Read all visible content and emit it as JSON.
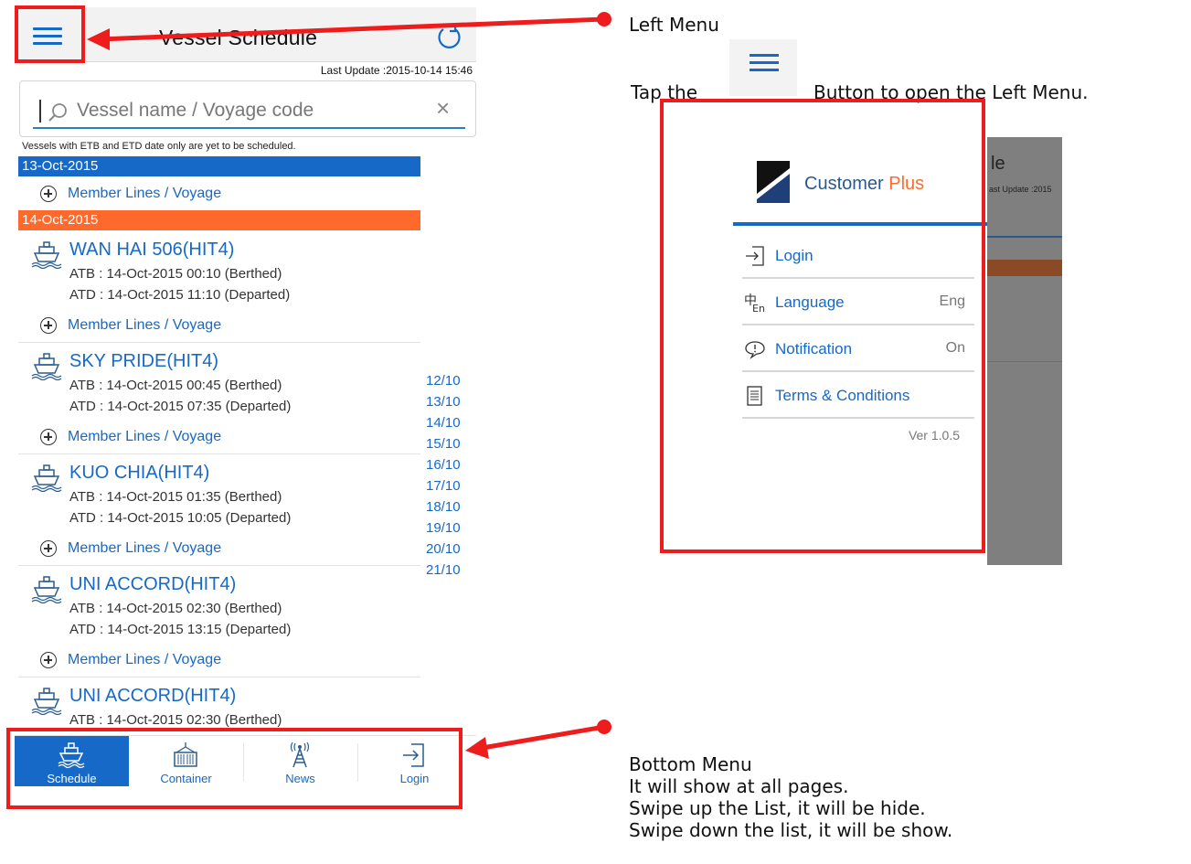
{
  "app": {
    "title": "Vessel Schedule",
    "last_update": "Last Update :2015-10-14 15:46",
    "search": {
      "placeholder": "Vessel name / Voyage code",
      "clear": "×"
    },
    "notice": "Vessels with ETB and ETD date only are yet to be scheduled.",
    "groups": [
      {
        "date": "13-Oct-2015",
        "color": "#1769c7",
        "member_lines": "Member Lines / Voyage"
      },
      {
        "date": "14-Oct-2015",
        "color": "#ff6a2c"
      }
    ],
    "vessels": [
      {
        "name": "WAN HAI 506(HIT4)",
        "atb": "ATB : 14-Oct-2015 00:10 (Berthed)",
        "atd": "ATD : 14-Oct-2015 11:10 (Departed)",
        "member_lines": "Member Lines / Voyage"
      },
      {
        "name": "SKY PRIDE(HIT4)",
        "atb": "ATB : 14-Oct-2015 00:45 (Berthed)",
        "atd": "ATD : 14-Oct-2015 07:35 (Departed)",
        "member_lines": "Member Lines / Voyage"
      },
      {
        "name": "KUO CHIA(HIT4)",
        "atb": "ATB : 14-Oct-2015 01:35 (Berthed)",
        "atd": "ATD : 14-Oct-2015 10:05 (Departed)",
        "member_lines": "Member Lines / Voyage"
      },
      {
        "name": "UNI ACCORD(HIT4)",
        "atb": "ATB : 14-Oct-2015 02:30 (Berthed)",
        "atd": "ATD : 14-Oct-2015 13:15 (Departed)",
        "member_lines": "Member Lines / Voyage"
      },
      {
        "name": "UNI ACCORD(HIT4)",
        "atb": "ATB : 14-Oct-2015 02:30 (Berthed)"
      }
    ],
    "date_index": [
      "12/10",
      "13/10",
      "14/10",
      "15/10",
      "16/10",
      "17/10",
      "18/10",
      "19/10",
      "20/10",
      "21/10"
    ],
    "bottom_nav": [
      {
        "label": "Schedule",
        "icon": "ship-icon",
        "active": true
      },
      {
        "label": "Container",
        "icon": "container-icon",
        "active": false
      },
      {
        "label": "News",
        "icon": "antenna-icon",
        "active": false
      },
      {
        "label": "Login",
        "icon": "login-icon",
        "active": false
      }
    ]
  },
  "annotations": {
    "left_menu": {
      "heading": "Left Menu",
      "tap_before": "Tap the",
      "tap_after": "Button to open the Left Menu."
    },
    "bottom_menu": {
      "lines": [
        "Bottom Menu",
        "It will show at all pages.",
        "Swipe up the List, it will be hide.",
        "Swipe down the list, it will be show."
      ]
    }
  },
  "left_menu": {
    "brand": {
      "name": "Customer",
      "accent": "Plus"
    },
    "items": [
      {
        "label": "Login",
        "icon": "login-icon",
        "value": ""
      },
      {
        "label": "Language",
        "icon": "language-icon",
        "value": "Eng"
      },
      {
        "label": "Notification",
        "icon": "notification-icon",
        "value": "On"
      },
      {
        "label": "Terms & Conditions",
        "icon": "document-icon",
        "value": ""
      }
    ],
    "version": "Ver 1.0.5",
    "overlay": {
      "title_fragment": "le",
      "update_fragment": "ast Update :2015"
    }
  },
  "colors": {
    "accent": "#1769c7",
    "orange": "#ff6a2c",
    "annotation_red": "#ee1c1c"
  }
}
